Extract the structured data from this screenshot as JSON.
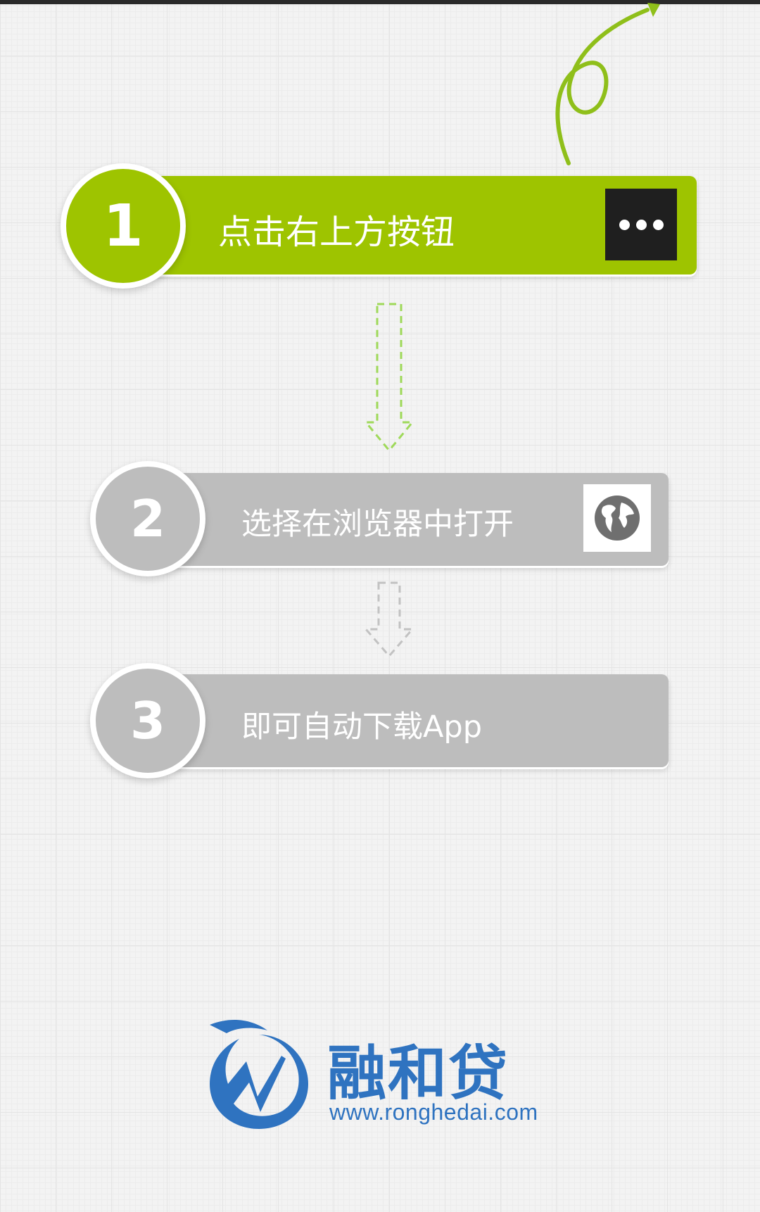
{
  "steps": [
    {
      "number": "1",
      "text": "点击右上方按钮",
      "icon": "more-dots-icon"
    },
    {
      "number": "2",
      "text": "选择在浏览器中打开",
      "icon": "globe-icon"
    },
    {
      "number": "3",
      "text": "即可自动下载App"
    }
  ],
  "brand": {
    "name": "融和贷",
    "url": "www.ronghedai.com"
  },
  "colors": {
    "active_green": "#9ec400",
    "inactive_gray": "#bdbdbd",
    "brand_blue": "#2f73c0"
  }
}
